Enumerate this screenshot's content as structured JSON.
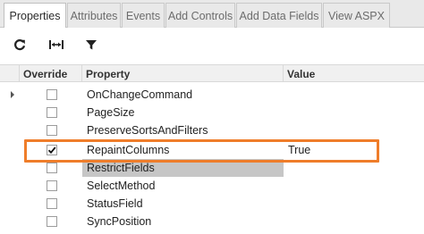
{
  "tabs": [
    {
      "label": "Properties",
      "active": true
    },
    {
      "label": "Attributes",
      "active": false
    },
    {
      "label": "Events",
      "active": false
    },
    {
      "label": "Add Controls",
      "active": false
    },
    {
      "label": "Add Data Fields",
      "active": false
    },
    {
      "label": "View ASPX",
      "active": false
    }
  ],
  "toolbar": {
    "refresh_icon": "refresh-icon",
    "fit_columns_icon": "fit-columns-icon",
    "filter_icon": "filter-icon"
  },
  "grid": {
    "columns": {
      "override": "Override",
      "property": "Property",
      "value": "Value"
    },
    "rows": [
      {
        "property": "OnChangeCommand",
        "override": false,
        "value": "",
        "current": true
      },
      {
        "property": "PageSize",
        "override": false,
        "value": ""
      },
      {
        "property": "PreserveSortsAndFilters",
        "override": false,
        "value": ""
      },
      {
        "property": "RepaintColumns",
        "override": true,
        "value": "True",
        "callout": true
      },
      {
        "property": "RestrictFields",
        "override": false,
        "value": "",
        "selected": true
      },
      {
        "property": "SelectMethod",
        "override": false,
        "value": ""
      },
      {
        "property": "StatusField",
        "override": false,
        "value": ""
      },
      {
        "property": "SyncPosition",
        "override": false,
        "value": ""
      }
    ]
  },
  "colors": {
    "accent_callout": "#ef7d2a",
    "selected_cell": "#c6c6c6",
    "header_bg": "#f0f0f0",
    "tab_bg": "#e9e9e9"
  }
}
